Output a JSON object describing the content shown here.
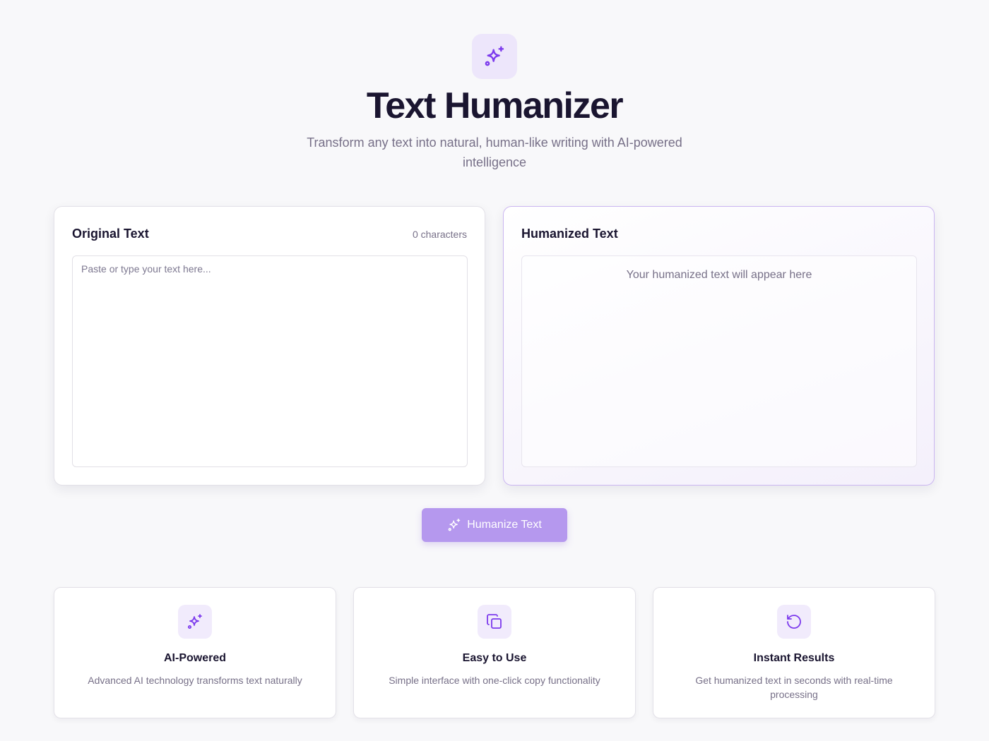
{
  "header": {
    "icon": "sparkles-icon",
    "title": "Text Humanizer",
    "subtitle": "Transform any text into natural, human-like writing with AI-powered intelligence"
  },
  "input_panel": {
    "title": "Original Text",
    "char_count": "0 characters",
    "value": "",
    "placeholder": "Paste or type your text here..."
  },
  "output_panel": {
    "title": "Humanized Text",
    "placeholder": "Your humanized text will appear here"
  },
  "action": {
    "label": "Humanize Text",
    "icon": "sparkles-icon"
  },
  "features": [
    {
      "icon": "sparkles-icon",
      "title": "AI-Powered",
      "description": "Advanced AI technology transforms text naturally"
    },
    {
      "icon": "copy-icon",
      "title": "Easy to Use",
      "description": "Simple interface with one-click copy functionality"
    },
    {
      "icon": "refresh-icon",
      "title": "Instant Results",
      "description": "Get humanized text in seconds with real-time processing"
    }
  ],
  "colors": {
    "accent": "#7c3aed",
    "accent_soft": "#ede6fb",
    "button": "#b598ee",
    "text_primary": "#1a1530",
    "text_muted": "#777088"
  }
}
